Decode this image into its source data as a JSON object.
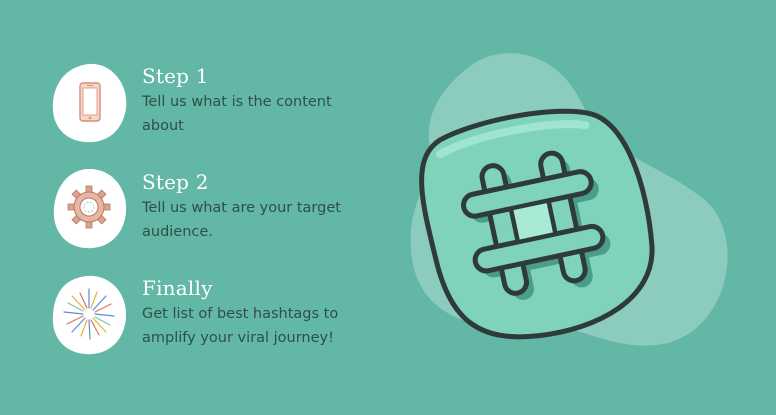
{
  "steps": [
    {
      "title": "Step 1",
      "description": "Tell us what is the content about",
      "icon": "phone-icon"
    },
    {
      "title": "Step 2",
      "description": "Tell us what are your target audience.",
      "icon": "gear-icon"
    },
    {
      "title": "Finally",
      "description": "Get list of best hashtags to amplify your viral journey!",
      "icon": "fireworks-icon"
    }
  ],
  "hero": {
    "icon": "hashtag-icon"
  },
  "colors": {
    "background": "#62b7a7",
    "text_dark": "#2f4f49",
    "title_white": "#ffffff",
    "hashtag_fill": "#7fd3bb",
    "outline": "#2f3b3a"
  }
}
